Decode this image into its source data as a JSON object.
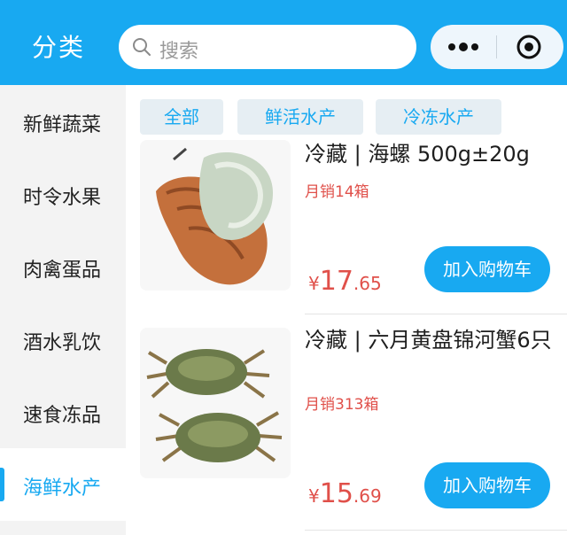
{
  "header": {
    "title": "分类",
    "search_placeholder": "搜索",
    "accent_color": "#18a9f1"
  },
  "sidebar": {
    "items": [
      {
        "label": "新鲜蔬菜",
        "active": false
      },
      {
        "label": "时令水果",
        "active": false
      },
      {
        "label": "肉禽蛋品",
        "active": false
      },
      {
        "label": "酒水乳饮",
        "active": false
      },
      {
        "label": "速食冻品",
        "active": false
      },
      {
        "label": "海鲜水产",
        "active": true
      }
    ]
  },
  "tabs": [
    {
      "label": "全部"
    },
    {
      "label": "鲜活水产"
    },
    {
      "label": "冷冻水产"
    }
  ],
  "products": [
    {
      "name": "冷藏 | 海螺 500g±20g",
      "sales": "月销14箱",
      "price_currency": "¥",
      "price_int": "17",
      "price_dec": ".65",
      "cart_label": "加入购物车",
      "image_icon": "conch-image"
    },
    {
      "name": "冷藏 | 六月黄盘锦河蟹6只",
      "sales": "月销313箱",
      "price_currency": "¥",
      "price_int": "15",
      "price_dec": ".69",
      "cart_label": "加入购物车",
      "image_icon": "crab-image"
    }
  ]
}
